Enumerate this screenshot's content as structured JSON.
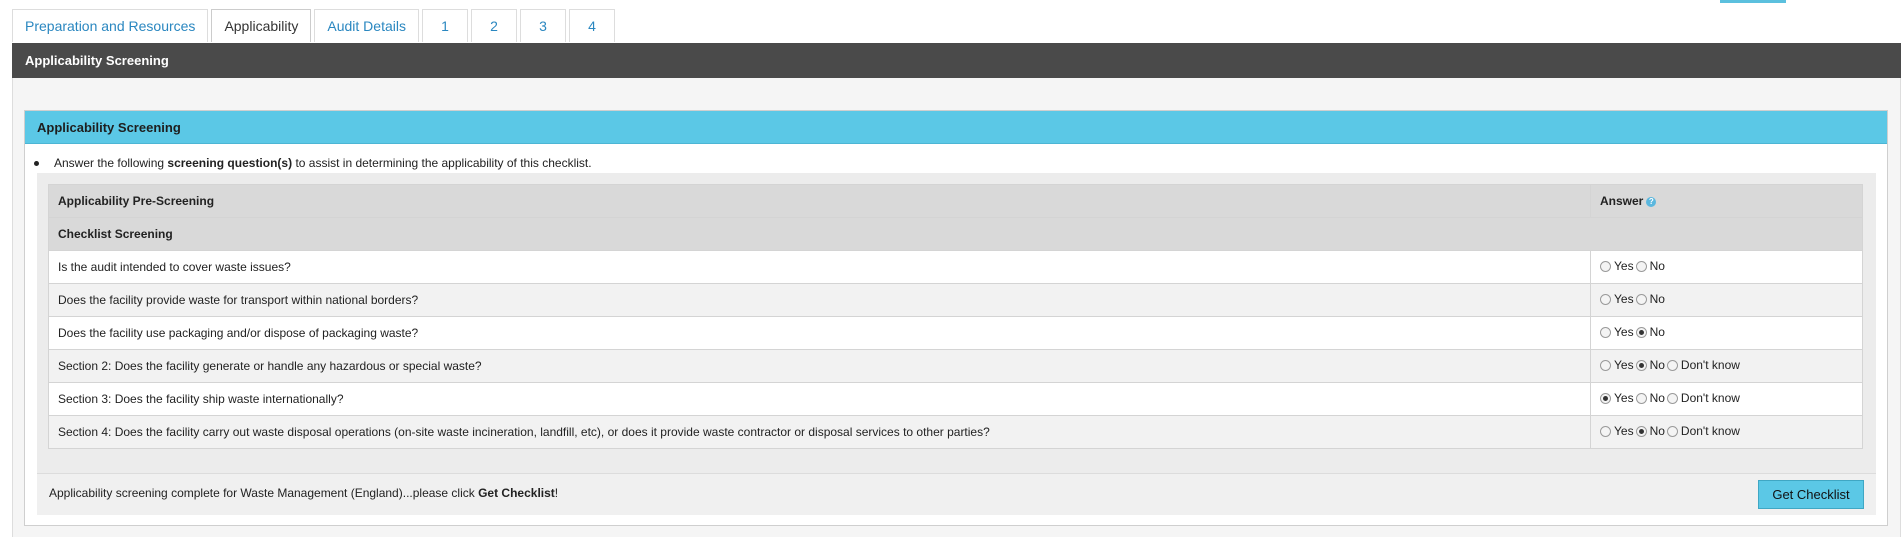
{
  "tabs": [
    {
      "label": "Preparation and Resources",
      "active": false
    },
    {
      "label": "Applicability",
      "active": true
    },
    {
      "label": "Audit Details",
      "active": false
    },
    {
      "label": "1",
      "active": false
    },
    {
      "label": "2",
      "active": false
    },
    {
      "label": "3",
      "active": false
    },
    {
      "label": "4",
      "active": false
    }
  ],
  "main_header": "Applicability Screening",
  "panel": {
    "title": "Applicability Screening",
    "instruction_prefix": "Answer the following ",
    "instruction_bold": "screening question(s)",
    "instruction_suffix": " to assist in determining the applicability of this checklist."
  },
  "table": {
    "col_question": "Applicability Pre-Screening",
    "col_answer": "Answer",
    "help_icon": "?",
    "section_label": "Checklist Screening",
    "rows": [
      {
        "question": "Is the audit intended to cover waste issues?",
        "options": [
          "Yes",
          "No"
        ],
        "selected": null
      },
      {
        "question": "Does the facility provide waste for transport within national borders?",
        "options": [
          "Yes",
          "No"
        ],
        "selected": null
      },
      {
        "question": "Does the facility use packaging and/or dispose of packaging waste?",
        "options": [
          "Yes",
          "No"
        ],
        "selected": "No"
      },
      {
        "question": "Section 2: Does the facility generate or handle any hazardous or special waste?",
        "options": [
          "Yes",
          "No",
          "Don't know"
        ],
        "selected": "No"
      },
      {
        "question": "Section 3: Does the facility ship waste internationally?",
        "options": [
          "Yes",
          "No",
          "Don't know"
        ],
        "selected": "Yes"
      },
      {
        "question": "Section 4: Does the facility carry out waste disposal operations (on-site waste incineration, landfill, etc), or does it provide waste contractor or disposal services to other parties?",
        "options": [
          "Yes",
          "No",
          "Don't know"
        ],
        "selected": "No"
      }
    ]
  },
  "footer": {
    "text_prefix": "Applicability screening complete for Waste Management (England)...please click ",
    "text_bold": "Get Checklist",
    "text_suffix": "!",
    "button_label": "Get Checklist"
  },
  "colors": {
    "accent": "#5bc8e6",
    "header_dark": "#4a4a4a",
    "tab_link": "#2a87c0"
  }
}
